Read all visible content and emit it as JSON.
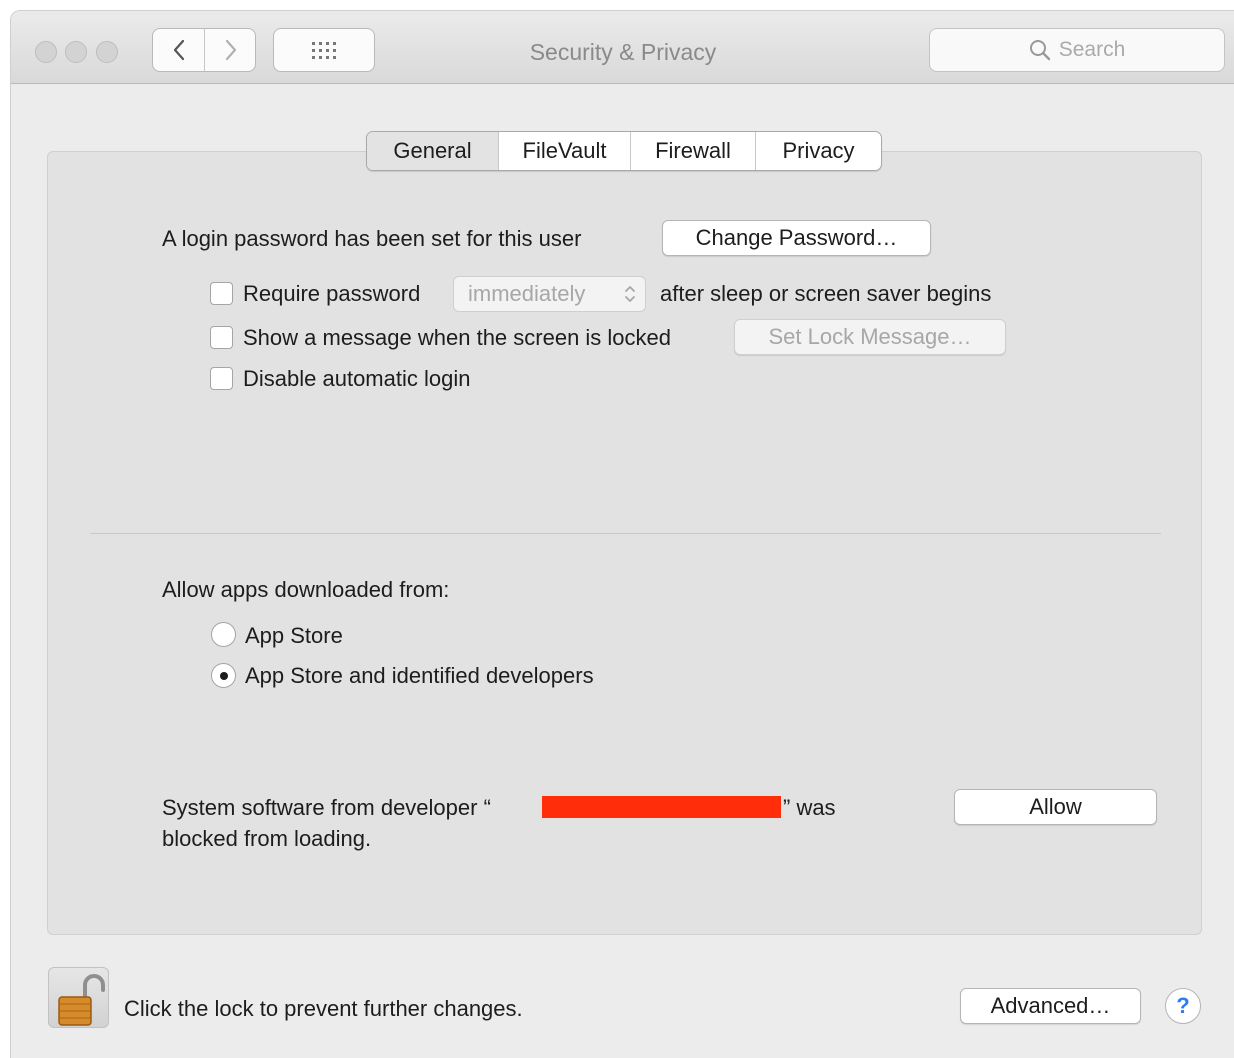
{
  "window": {
    "title": "Security & Privacy",
    "search_placeholder": "Search"
  },
  "tabs": [
    "General",
    "FileVault",
    "Firewall",
    "Privacy"
  ],
  "active_tab": "General",
  "general": {
    "login_text": "A login password has been set for this user",
    "change_password_label": "Change Password…",
    "require_password_label": "Require password",
    "require_password_checked": false,
    "require_password_select": "immediately",
    "require_password_suffix": "after sleep or screen saver begins",
    "show_message_label": "Show a message when the screen is locked",
    "show_message_checked": false,
    "set_lock_message_label": "Set Lock Message…",
    "disable_auto_login_label": "Disable automatic login",
    "disable_auto_login_checked": false
  },
  "apps": {
    "heading": "Allow apps downloaded from:",
    "options": [
      "App Store",
      "App Store and identified developers"
    ],
    "selected": "App Store and identified developers"
  },
  "blocked": {
    "prefix": "System software from developer “",
    "suffix": "” was",
    "line2": "blocked from loading.",
    "redaction_color": "#ff2d09",
    "allow_label": "Allow"
  },
  "footer": {
    "lock_text": "Click the lock to prevent further changes.",
    "advanced_label": "Advanced…",
    "help_label": "?"
  },
  "colors": {
    "window_bg": "#ececec",
    "panel_bg": "#e2e2e2",
    "help_accent": "#2d7cf0"
  }
}
